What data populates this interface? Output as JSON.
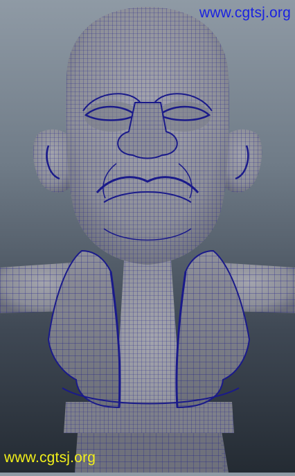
{
  "viewport": {
    "subject": "character-head-wireframe",
    "background_top": "#8f9aa5",
    "background_bottom": "#242b33",
    "mesh_fill": "#8d8f98",
    "mesh_shadow": "#6b6e7a",
    "wire_color": "#1a1a8a"
  },
  "watermarks": {
    "top": {
      "text": "www.cgtsj.org",
      "color": "#1a22e0"
    },
    "bottom": {
      "text": "www.cgtsj.org",
      "color": "#f2ef1a"
    }
  }
}
